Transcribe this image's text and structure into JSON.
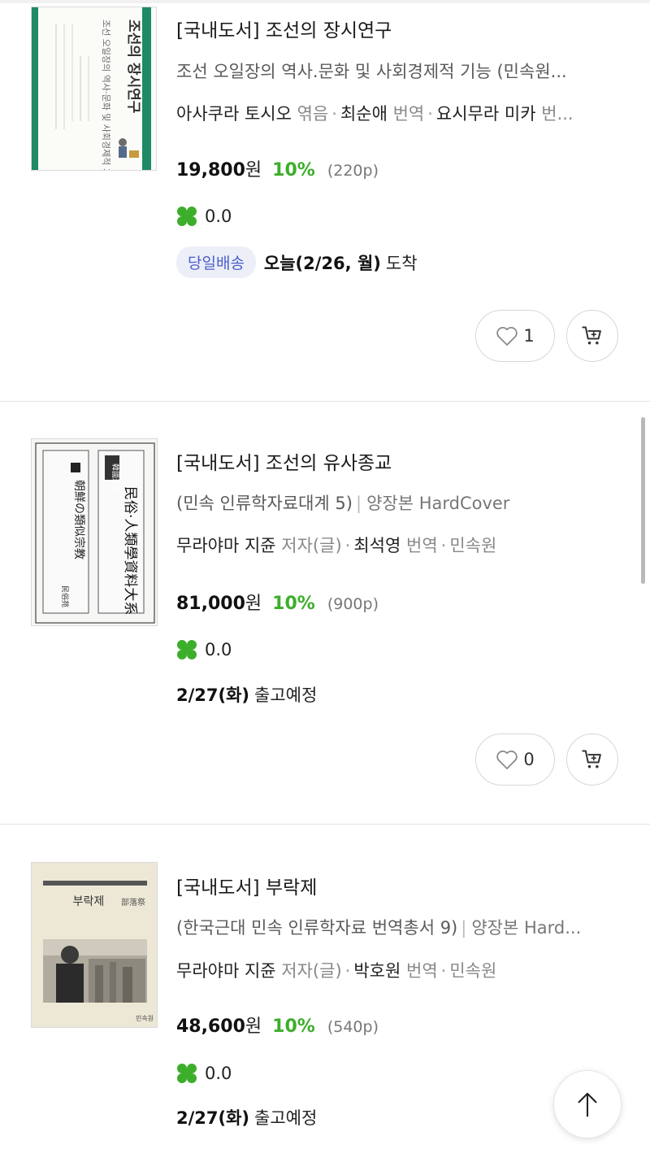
{
  "books": [
    {
      "title": "[국내도서] 조선의 장시연구",
      "subtitle": "조선 오일장의 역사.문화 및 사회경제적 기능 (민속원...",
      "binding": "",
      "authors": [
        {
          "name": "아사쿠라 토시오",
          "role": "엮음"
        },
        {
          "name": "최순애",
          "role": "번역"
        },
        {
          "name": "요시무라 미카",
          "role": "번..."
        }
      ],
      "publisher": "",
      "price": "19,800",
      "currency": "원",
      "discount": "10%",
      "pages": "(220p)",
      "rating": "0.0",
      "delivery_badge": "당일배송",
      "delivery_strong": "오늘(2/26, 월)",
      "delivery_rest": "도착",
      "likes": "1",
      "cover": {
        "spine_title": "조선의 장시연구",
        "spine_sub": "조선 오일장의 역사·문화 및 사회경제적 기능",
        "accent": "#1f8a66"
      }
    },
    {
      "title": "[국내도서] 조선의 유사종교",
      "subtitle": "(민속 인류학자료대계 5)",
      "binding": "양장본 HardCover",
      "authors": [
        {
          "name": "무라야마 지쥰",
          "role": "저자(글)"
        },
        {
          "name": "최석영",
          "role": "번역"
        }
      ],
      "publisher": "민속원",
      "price": "81,000",
      "currency": "원",
      "discount": "10%",
      "pages": "(900p)",
      "rating": "0.0",
      "delivery_badge": "",
      "delivery_strong": "2/27(화)",
      "delivery_rest": "출고예정",
      "likes": "0",
      "cover": {
        "left_text": "朝鮮の類似宗教",
        "right_text": "民俗·人類學資料大系",
        "tag": "韓國近代",
        "publisher_mark": "民俗苑"
      }
    },
    {
      "title": "[국내도서] 부락제",
      "subtitle": "(한국근대 민속 인류학자료 번역총서 9)",
      "binding": "양장본 Hard...",
      "authors": [
        {
          "name": "무라야마 지쥰",
          "role": "저자(글)"
        },
        {
          "name": "박호원",
          "role": "번역"
        }
      ],
      "publisher": "민속원",
      "price": "48,600",
      "currency": "원",
      "discount": "10%",
      "pages": "(540p)",
      "rating": "0.0",
      "delivery_badge": "",
      "delivery_strong": "2/27(화)",
      "delivery_rest": "출고예정",
      "likes": "",
      "cover": {
        "title": "부락제",
        "hanja": "部落祭",
        "publisher_mark": "민속원"
      }
    }
  ],
  "colors": {
    "discount": "#3dae2b",
    "badge_bg": "#eceff8",
    "badge_text": "#4a5ec9"
  }
}
